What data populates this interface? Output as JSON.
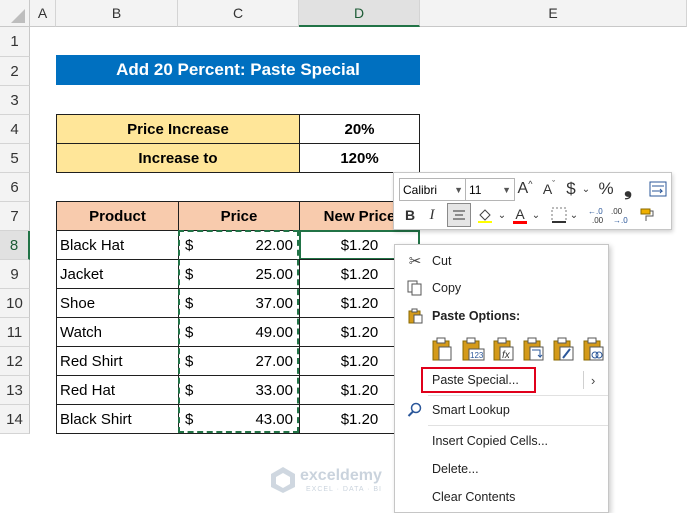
{
  "columns": [
    "A",
    "B",
    "C",
    "D",
    "E"
  ],
  "rows": [
    "1",
    "2",
    "3",
    "4",
    "5",
    "6",
    "7",
    "8",
    "9",
    "10",
    "11",
    "12",
    "13",
    "14"
  ],
  "title": "Add 20 Percent: Paste Special",
  "summary": {
    "increase_label": "Price Increase",
    "increase_value": "20%",
    "increase_to_label": "Increase to",
    "increase_to_value": "120%"
  },
  "table": {
    "headers": [
      "Product",
      "Price",
      "New Price"
    ],
    "rows": [
      {
        "product": "Black Hat",
        "sign": "$",
        "price": "22.00",
        "new": "$1.20"
      },
      {
        "product": "Jacket",
        "sign": "$",
        "price": "25.00",
        "new": "$1.20"
      },
      {
        "product": "Shoe",
        "sign": "$",
        "price": "37.00",
        "new": "$1.20"
      },
      {
        "product": "Watch",
        "sign": "$",
        "price": "49.00",
        "new": "$1.20"
      },
      {
        "product": "Red Shirt",
        "sign": "$",
        "price": "27.00",
        "new": "$1.20"
      },
      {
        "product": "Red Hat",
        "sign": "$",
        "price": "33.00",
        "new": "$1.20"
      },
      {
        "product": "Black Shirt",
        "sign": "$",
        "price": "43.00",
        "new": "$1.20"
      }
    ]
  },
  "mini_toolbar": {
    "font": "Calibri",
    "size": "11",
    "grow_font": "A",
    "shrink_font": "A",
    "currency": "$",
    "percent": "%",
    "comma": "❟",
    "bold": "B",
    "italic": "I",
    "font_color_glyph": "A"
  },
  "context_menu": {
    "cut": "Cut",
    "copy": "Copy",
    "paste_options": "Paste Options:",
    "paste_special": "Paste Special...",
    "smart_lookup": "Smart Lookup",
    "insert_copied": "Insert Copied Cells...",
    "delete": "Delete...",
    "clear_contents": "Clear Contents"
  },
  "watermark": {
    "name": "exceldemy",
    "tagline": "EXCEL · DATA · BI"
  },
  "colors": {
    "title_bg": "#0070c0",
    "yellow": "#ffe699",
    "header_bg": "#f8cbad",
    "excel_green": "#217346",
    "highlight": "#e0001b"
  }
}
